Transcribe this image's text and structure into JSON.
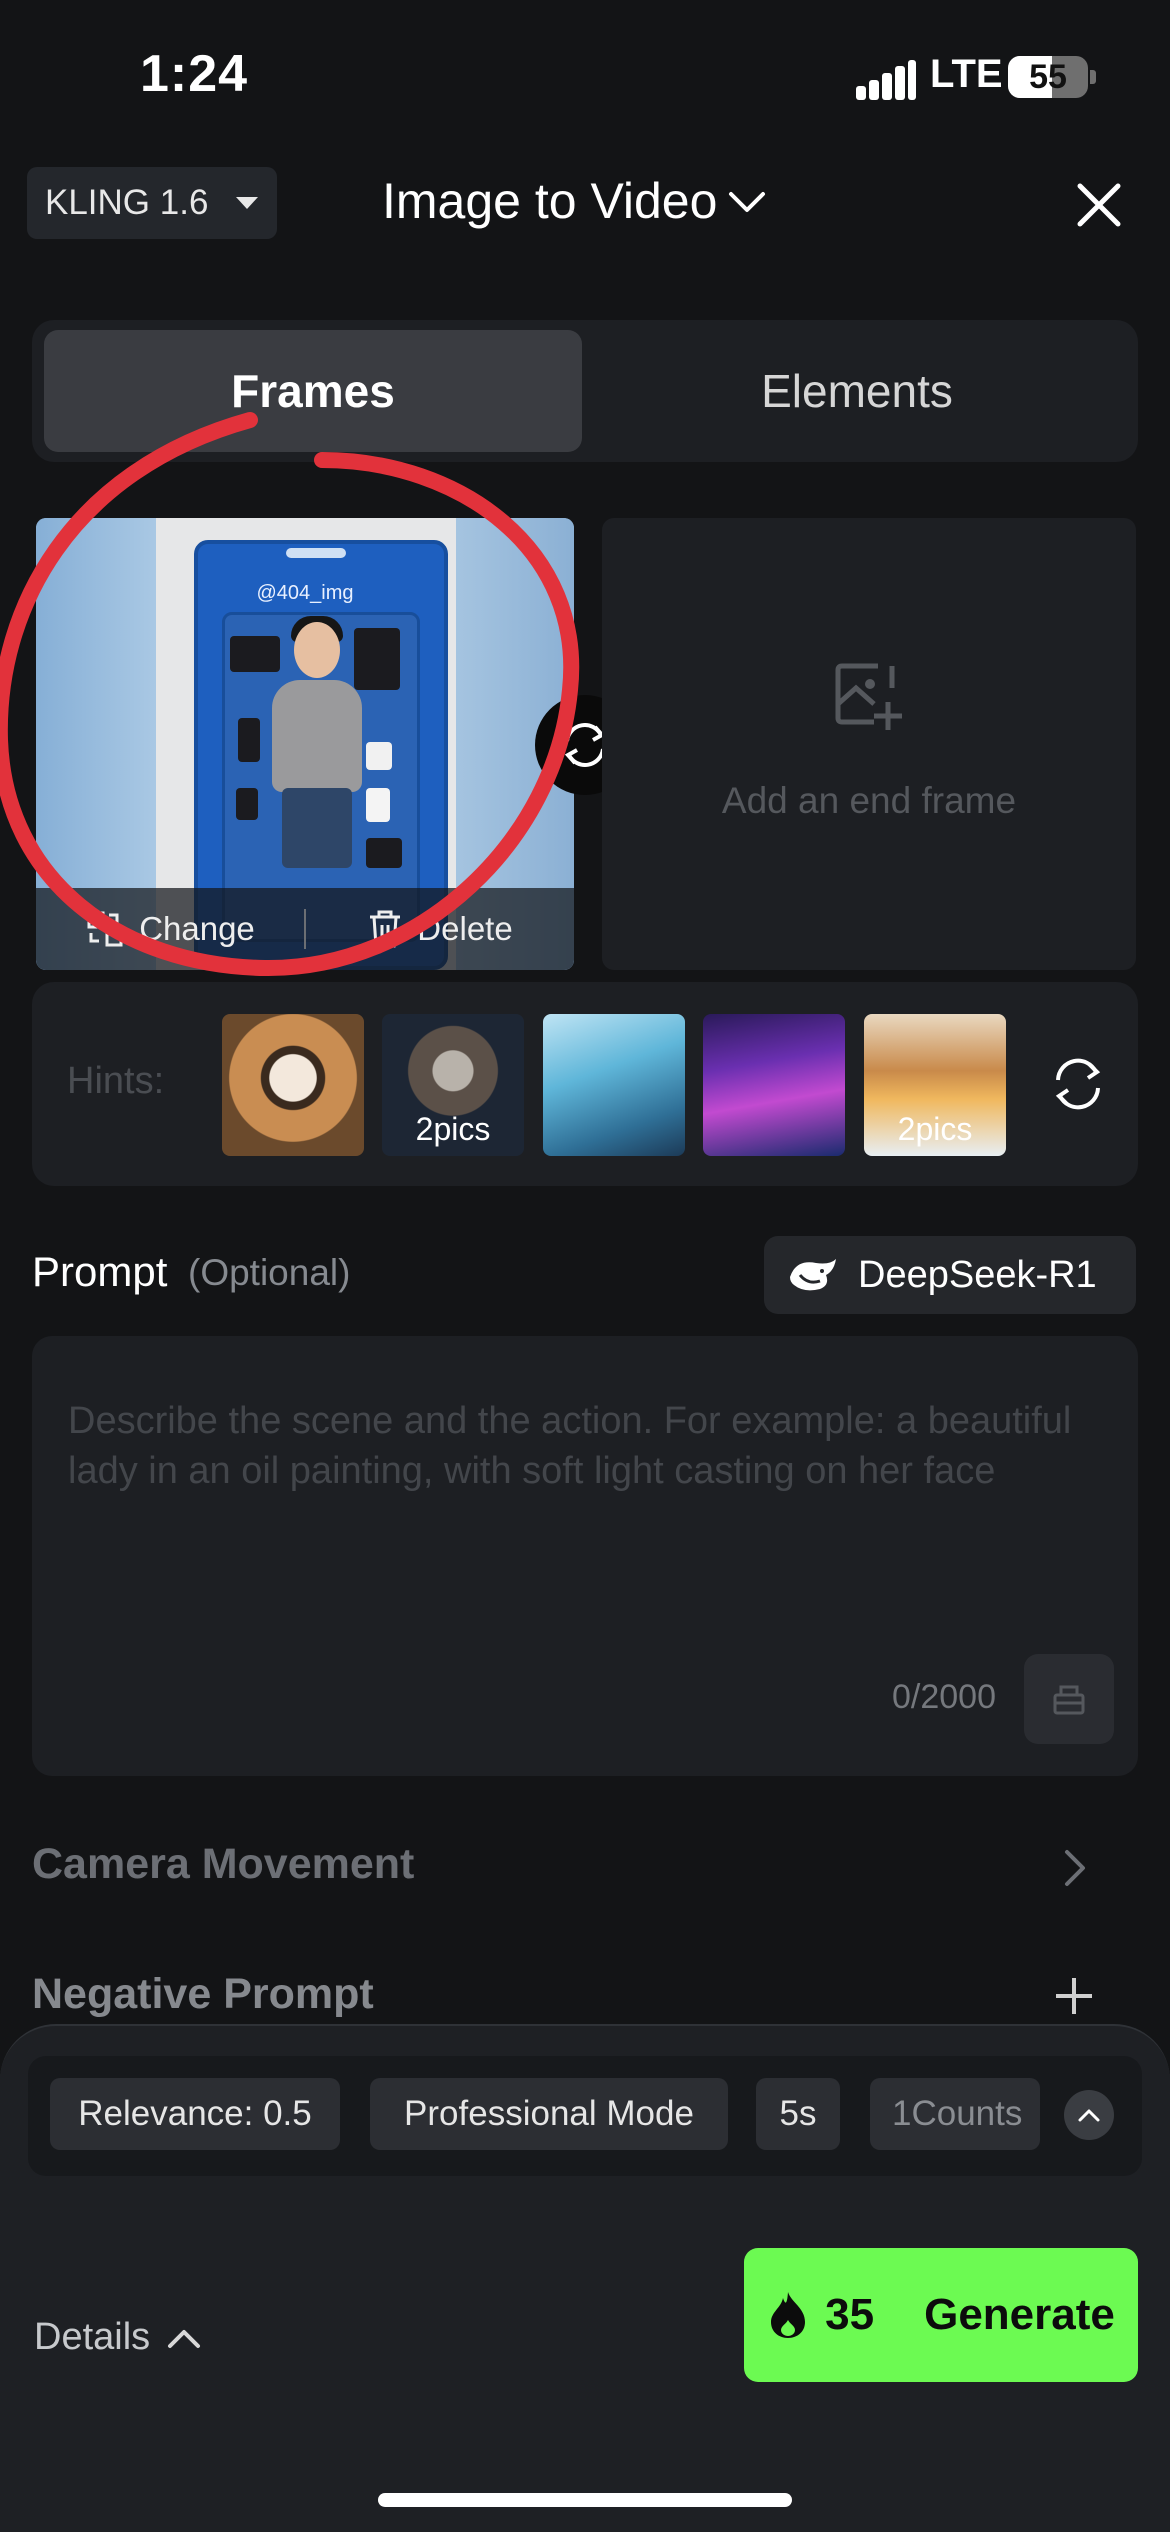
{
  "status_bar": {
    "time": "1:24",
    "network": "LTE",
    "battery": "55"
  },
  "header": {
    "model_label": "KLING 1.6",
    "mode_title": "Image to Video"
  },
  "tabs": [
    {
      "label": "Frames"
    },
    {
      "label": "Elements"
    }
  ],
  "start_frame": {
    "watermark": "@404_img",
    "change_label": "Change",
    "delete_label": "Delete"
  },
  "end_frame": {
    "placeholder": "Add an end frame"
  },
  "hints": {
    "label": "Hints:",
    "items": [
      {
        "caption": "",
        "theme": "panda"
      },
      {
        "caption": "2pics",
        "theme": "warrior-girl"
      },
      {
        "caption": "",
        "theme": "blue-haired-girl"
      },
      {
        "caption": "",
        "theme": "neon-city"
      },
      {
        "caption": "2pics",
        "theme": "snow-cabin"
      }
    ]
  },
  "prompt": {
    "label": "Prompt",
    "optional_label": "(Optional)",
    "model_button": "DeepSeek-R1",
    "placeholder": "Describe the scene and the action. For example: a beautiful lady in an oil painting, with soft light casting on her face",
    "counter": "0/2000"
  },
  "sections": {
    "camera_movement": "Camera Movement",
    "negative_prompt": "Negative Prompt"
  },
  "settings_chips": {
    "relevance": "Relevance: 0.5",
    "mode": "Professional Mode",
    "duration": "5s",
    "count": "1Counts"
  },
  "footer": {
    "details_label": "Details",
    "credits": "35",
    "generate_label": "Generate",
    "accent_color": "#6cfa52"
  }
}
